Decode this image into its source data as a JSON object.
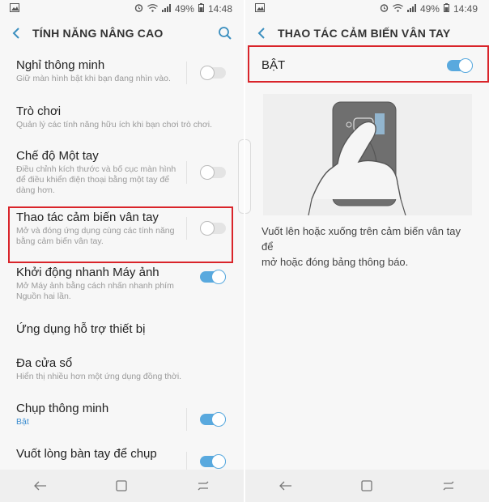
{
  "left": {
    "status": {
      "battery": "49%",
      "time": "14:48"
    },
    "title": "TÍNH NĂNG NÂNG CAO",
    "items": [
      {
        "title": "Nghỉ thông minh",
        "subtitle": "Giữ màn hình bật khi bạn đang nhìn vào.",
        "toggle": "off"
      },
      {
        "title": "Trò chơi",
        "subtitle": "Quản lý các tính năng hữu ích khi bạn chơi trò chơi.",
        "toggle": "none"
      },
      {
        "title": "Chế độ Một tay",
        "subtitle_lines": [
          "Điều chỉnh kích thước và bố cục màn hình",
          "để điều khiển điện thoại bằng một tay để",
          "dàng hơn."
        ],
        "toggle": "off"
      },
      {
        "title": "Thao tác cảm biến vân tay",
        "subtitle_lines": [
          "Mở và đóng ứng dụng cùng các tính năng",
          "bằng cảm biến vân tay."
        ],
        "toggle": "off"
      },
      {
        "title": "Khởi động nhanh Máy ảnh",
        "subtitle_lines": [
          "Mở Máy ảnh bằng cách nhấn nhanh phím",
          "Nguồn hai lần."
        ],
        "toggle": "on"
      },
      {
        "title": "Ứng dụng hỗ trợ thiết bị",
        "toggle": "none"
      },
      {
        "title": "Đa cửa sổ",
        "subtitle": "Hiển thị nhiều hơn một ứng dụng đồng thời.",
        "toggle": "none"
      },
      {
        "title": "Chụp thông minh",
        "subtitle": "Bật",
        "toggle": "on"
      },
      {
        "title": "Vuốt lòng bàn tay để chụp",
        "toggle": "on"
      }
    ]
  },
  "right": {
    "status": {
      "battery": "49%",
      "time": "14:49"
    },
    "title": "THAO TÁC CẢM BIẾN VÂN TAY",
    "switch_label": "BẬT",
    "switch_state": "on",
    "description_lines": [
      "Vuốt lên hoặc xuống trên cảm biến vân tay để",
      "mở hoặc đóng bảng thông báo."
    ]
  },
  "colors": {
    "accent": "#59a9de",
    "highlight": "#d9242a",
    "subtitle_blue": "#3e8ed0"
  }
}
